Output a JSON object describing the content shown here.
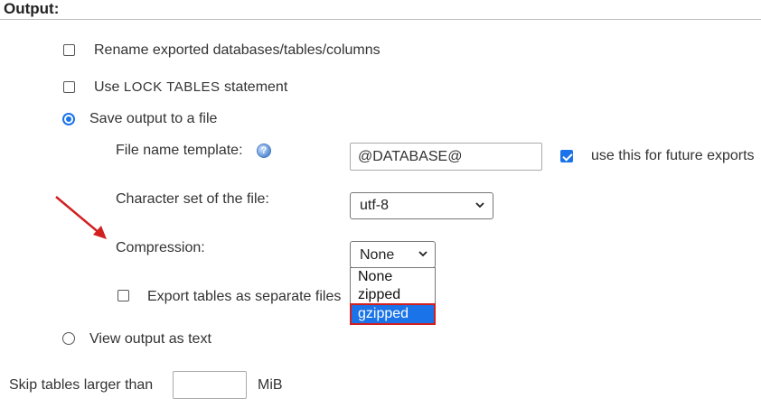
{
  "section": {
    "title": "Output:"
  },
  "options": {
    "rename": {
      "label": "Rename exported databases/tables/columns",
      "checked": false
    },
    "lock_tables": {
      "prefix": "Use",
      "code": "LOCK TABLES",
      "suffix": "statement",
      "checked": false
    },
    "save_to_file": {
      "label": "Save output to a file",
      "selected": true
    },
    "view_as_text": {
      "label": "View output as text",
      "selected": false
    }
  },
  "file_name_template": {
    "label": "File name template:",
    "help_icon": "question-help-icon",
    "value": "@DATABASE@",
    "remember_label": "use this for future exports",
    "remember_checked": true
  },
  "charset": {
    "label": "Character set of the file:",
    "selected": "utf-8"
  },
  "compression": {
    "label": "Compression:",
    "selected": "None",
    "options": [
      "None",
      "zipped",
      "gzipped"
    ],
    "highlighted": "gzipped"
  },
  "separate_files": {
    "label": "Export tables as separate files",
    "checked": false
  },
  "skip_tables": {
    "label": "Skip tables larger than",
    "value": "",
    "unit": "MiB"
  },
  "colors": {
    "accent": "#1a73e8",
    "annotation": "#d21f1f"
  }
}
